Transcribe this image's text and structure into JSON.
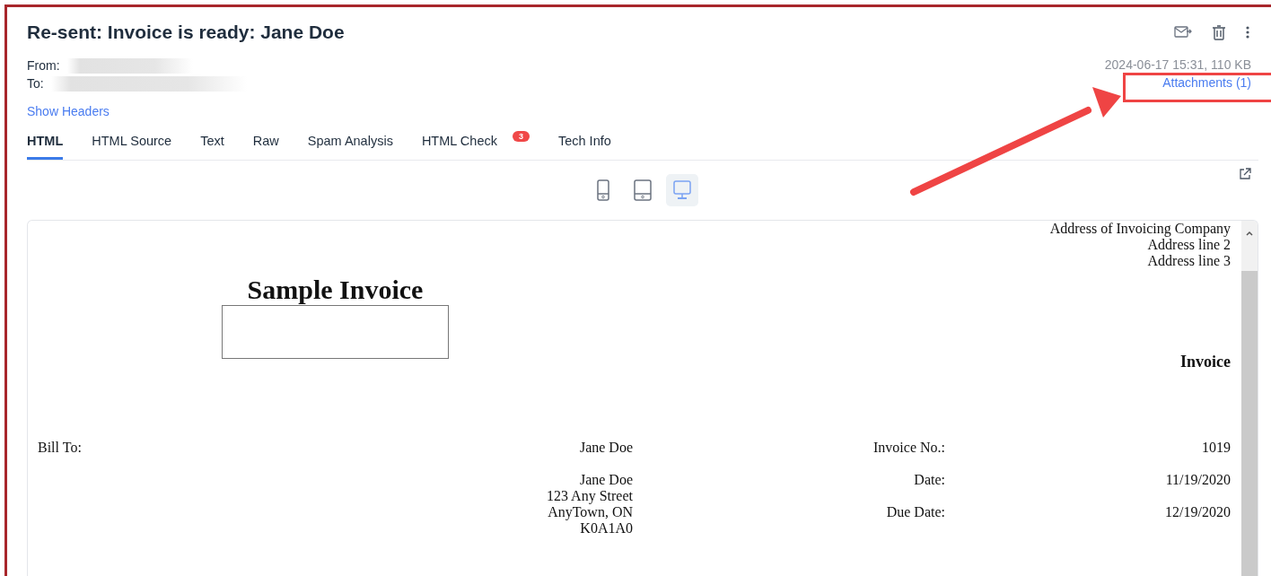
{
  "email": {
    "subject": "Re-sent: Invoice is ready: Jane Doe",
    "from_label": "From:",
    "to_label": "To:",
    "show_headers": "Show Headers",
    "meta": "2024-06-17 15:31, 110 KB",
    "attachments": "Attachments (1)"
  },
  "tabs": [
    {
      "label": "HTML",
      "selected": true
    },
    {
      "label": "HTML Source",
      "selected": false
    },
    {
      "label": "Text",
      "selected": false
    },
    {
      "label": "Raw",
      "selected": false
    },
    {
      "label": "Spam Analysis",
      "selected": false
    },
    {
      "label": "HTML Check",
      "selected": false,
      "badge": "3"
    },
    {
      "label": "Tech Info",
      "selected": false
    }
  ],
  "devices": [
    {
      "kind": "phone",
      "selected": false
    },
    {
      "kind": "tablet",
      "selected": false
    },
    {
      "kind": "desktop",
      "selected": true
    }
  ],
  "invoice": {
    "company_lines": [
      "Address of Invoicing Company",
      "Address line 2",
      "Address line 3"
    ],
    "title": "Sample Invoice",
    "heading": "Invoice",
    "bill_to_label": "Bill To:",
    "bill_to_name": "Jane Doe",
    "address_lines": [
      "Jane Doe",
      "123 Any Street",
      "AnyTown, ON",
      "K0A1A0"
    ],
    "fields": [
      {
        "label": "Invoice No.:",
        "value": "1019"
      },
      {
        "label": "Date:",
        "value": "11/19/2020"
      },
      {
        "label": "Due Date:",
        "value": "12/19/2020"
      }
    ]
  }
}
